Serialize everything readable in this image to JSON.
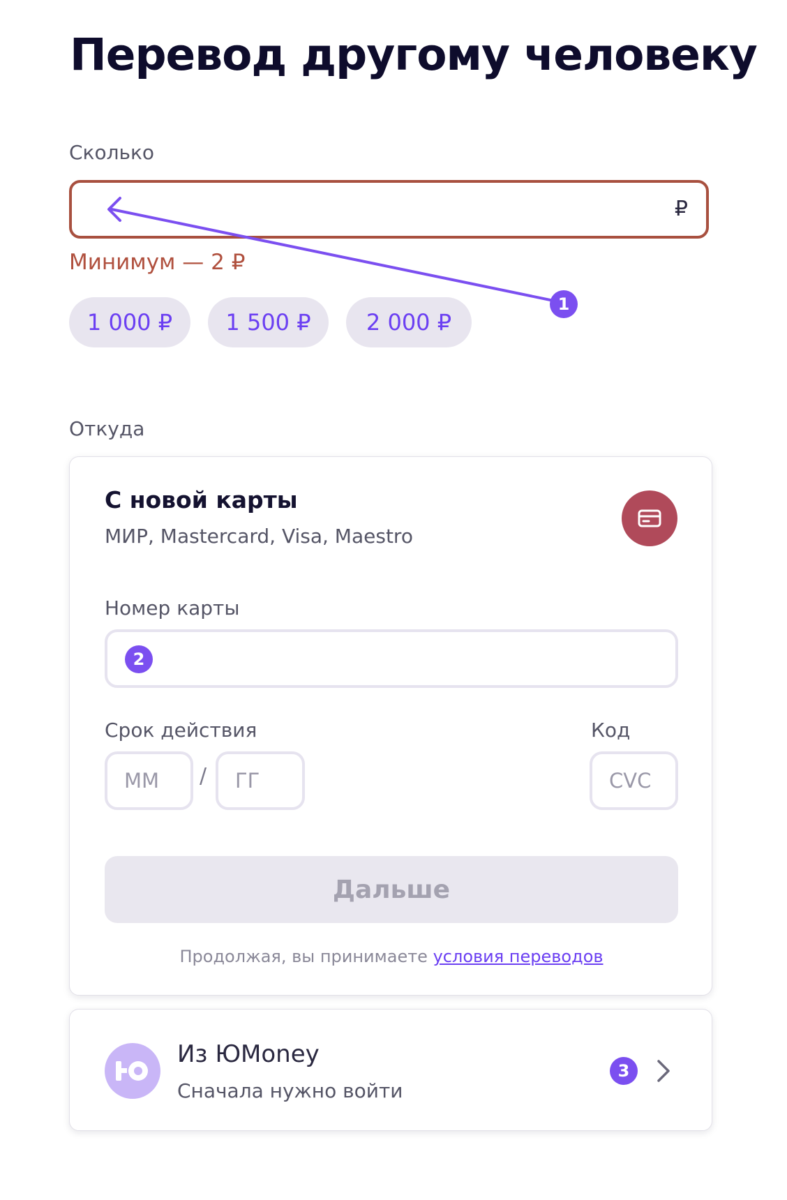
{
  "page": {
    "title": "Перевод другому человеку"
  },
  "amount": {
    "label": "Сколько",
    "value": "",
    "currency": "₽",
    "error": "Минимум — 2 ₽",
    "presets": [
      "1 000 ₽",
      "1 500 ₽",
      "2 000 ₽"
    ]
  },
  "source": {
    "label": "Откуда",
    "new_card": {
      "title": "С новой карты",
      "subtitle": "МИР, Mastercard, Visa, Maestro",
      "icon": "credit-card-icon",
      "card_number_label": "Номер карты",
      "card_number_value": "",
      "expiry_label": "Срок действия",
      "month_placeholder": "ММ",
      "year_placeholder": "ГГ",
      "expiry_separator": "/",
      "code_label": "Код",
      "cvc_placeholder": "CVC",
      "next_button": "Дальше",
      "terms_text": "Продолжая, вы принимаете ",
      "terms_link": "условия переводов"
    },
    "yoomoney": {
      "title": "Из ЮMoney",
      "subtitle": "Сначала нужно войти",
      "icon": "yoomoney-logo",
      "chevron_icon": "chevron-right-icon"
    }
  },
  "annotations": {
    "badge1": "1",
    "badge2": "2",
    "badge3": "3"
  },
  "colors": {
    "accent": "#6b3ff2",
    "error": "#b0503e",
    "card_icon_bg": "#b04a5a",
    "yoomoney_bg": "#c9b6f7",
    "annotation": "#7b4ff0"
  }
}
